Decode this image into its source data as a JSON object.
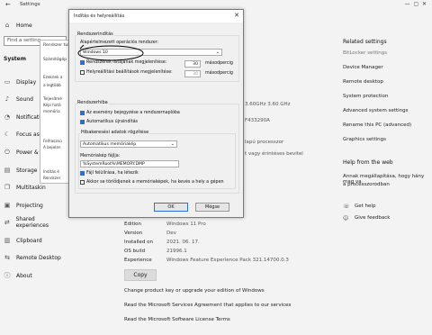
{
  "settings": {
    "window_title": "Settings",
    "home": "Home",
    "search_placeholder": "Find a setting",
    "system": "System",
    "nav": [
      {
        "label": "Display",
        "icon": "display-icon"
      },
      {
        "label": "Sound",
        "icon": "sound-icon"
      },
      {
        "label": "Notification",
        "icon": "bell-icon"
      },
      {
        "label": "Focus assist",
        "icon": "moon-icon"
      },
      {
        "label": "Power & sl",
        "icon": "power-icon"
      },
      {
        "label": "Storage",
        "icon": "storage-icon"
      },
      {
        "label": "Multitaskin",
        "icon": "multitask-icon"
      },
      {
        "label": "Projecting",
        "icon": "projector-icon"
      },
      {
        "label": "Shared experiences",
        "icon": "share-icon"
      },
      {
        "label": "Clipboard",
        "icon": "clipboard-icon"
      },
      {
        "label": "Remote Desktop",
        "icon": "remote-icon"
      },
      {
        "label": "About",
        "icon": "info-icon"
      }
    ],
    "right_panel": {
      "related_title": "Related settings",
      "related_links": [
        "BitLocker settings",
        "Device Manager",
        "Remote desktop",
        "System protection",
        "Advanced system settings",
        "Rename this PC (advanced)",
        "Graphics settings"
      ],
      "help_title": "Help from the web",
      "help_text_1": "Annak megállapítása, hogy hány mag va",
      "help_text_2": "a processzorodban",
      "get_help": "Get help",
      "feedback": "Give feedback"
    },
    "spec_fragments": {
      "cpu": "3.60GHz   3.60 GHz",
      "id": "F433290A",
      "proc": "lapú processzor",
      "touch": "t vagy érintéses bevitel"
    },
    "windows_specs": [
      {
        "k": "Edition",
        "v": "Windows 11 Pro"
      },
      {
        "k": "Version",
        "v": "Dev"
      },
      {
        "k": "Installed on",
        "v": "2021. 06. 17."
      },
      {
        "k": "OS build",
        "v": "21996.1"
      },
      {
        "k": "Experience",
        "v": "Windows Feature Experience Pack 321.14700.0.3"
      }
    ],
    "copy": "Copy",
    "bottom_links": [
      "Change product key or upgrade your edition of Windows",
      "Read the Microsoft Services Agreement that applies to our services",
      "Read the Microsoft Software License Terms"
    ]
  },
  "bg_dialog": {
    "title": "Rendszer tul",
    "tab": "Számítógép",
    "lines": [
      "Ezeknek a",
      "a legtöbb",
      "Teljesítmé",
      "Képi hatá",
      "memória",
      "Felhasznú",
      "A bejelen",
      "Indítás é",
      "Rendszer"
    ]
  },
  "dialog": {
    "title": "Indítás és helyreállítás",
    "startup_group": "Rendszerindítás",
    "default_os_label": "Alapértelmezett operációs rendszer:",
    "default_os_value": "Windows 10",
    "show_os_list": "Rendszerek listájának megjelenítése:",
    "show_os_seconds": "30",
    "show_recovery": "Helyreállítási beállítások megjelenítése:",
    "show_recovery_seconds": "30",
    "seconds_label": "másodpercig",
    "failure_group": "Rendszerhiba",
    "write_event": "Az esemény bejegyzése a rendszernaplóba",
    "auto_restart": "Automatikus újraindítás",
    "debug_group": "Hibakeresési adatok rögzítése",
    "debug_value": "Automatikus memóriakép",
    "dump_file_label": "Memóriakép fájlja:",
    "dump_file_value": "%SystemRoot%\\MEMORY.DMP",
    "overwrite": "Fájl felülírása, ha létezik",
    "disable_auto_delete": "Akkor se törlődjenek a memóriaképek, ha kevés a hely a gépen",
    "ok": "OK",
    "cancel": "Mégse"
  }
}
